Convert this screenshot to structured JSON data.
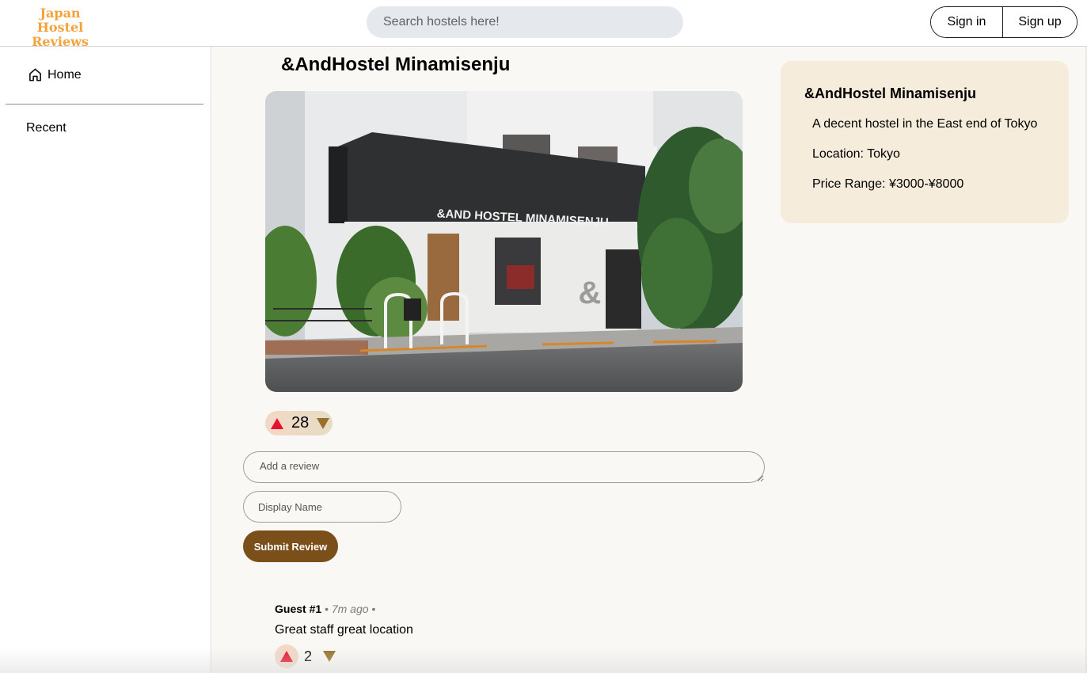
{
  "header": {
    "logo_line1": "Japan",
    "logo_line2": "Hostel Reviews",
    "search_placeholder": "Search hostels here!",
    "sign_in": "Sign in",
    "sign_up": "Sign up"
  },
  "sidebar": {
    "items": [
      {
        "label": "Home",
        "icon": "home-icon"
      },
      {
        "label": "Recent"
      }
    ]
  },
  "hostel": {
    "title": "&AndHostel Minamisenju",
    "photo_sign": "&AND HOSTEL MINAMISENJU",
    "photo_ampersand": "&",
    "votes": "28"
  },
  "review_form": {
    "review_placeholder": "Add a review",
    "name_placeholder": "Display Name",
    "submit_label": "Submit Review"
  },
  "comments": [
    {
      "author": "Guest #1",
      "time": "7m ago",
      "text": "Great staff great location",
      "votes": "2"
    }
  ],
  "info_card": {
    "name": "&AndHostel Minamisenju",
    "description": "A decent hostel in the East end of Tokyo",
    "location": "Location: Tokyo",
    "price_range": "Price Range: ¥3000-¥8000"
  },
  "colors": {
    "logo": "#f4a23b",
    "upvote": "#e8102c",
    "downvote": "#9a6f2a",
    "submit": "#7a4f1a",
    "info_card": "#f6ecdb"
  }
}
